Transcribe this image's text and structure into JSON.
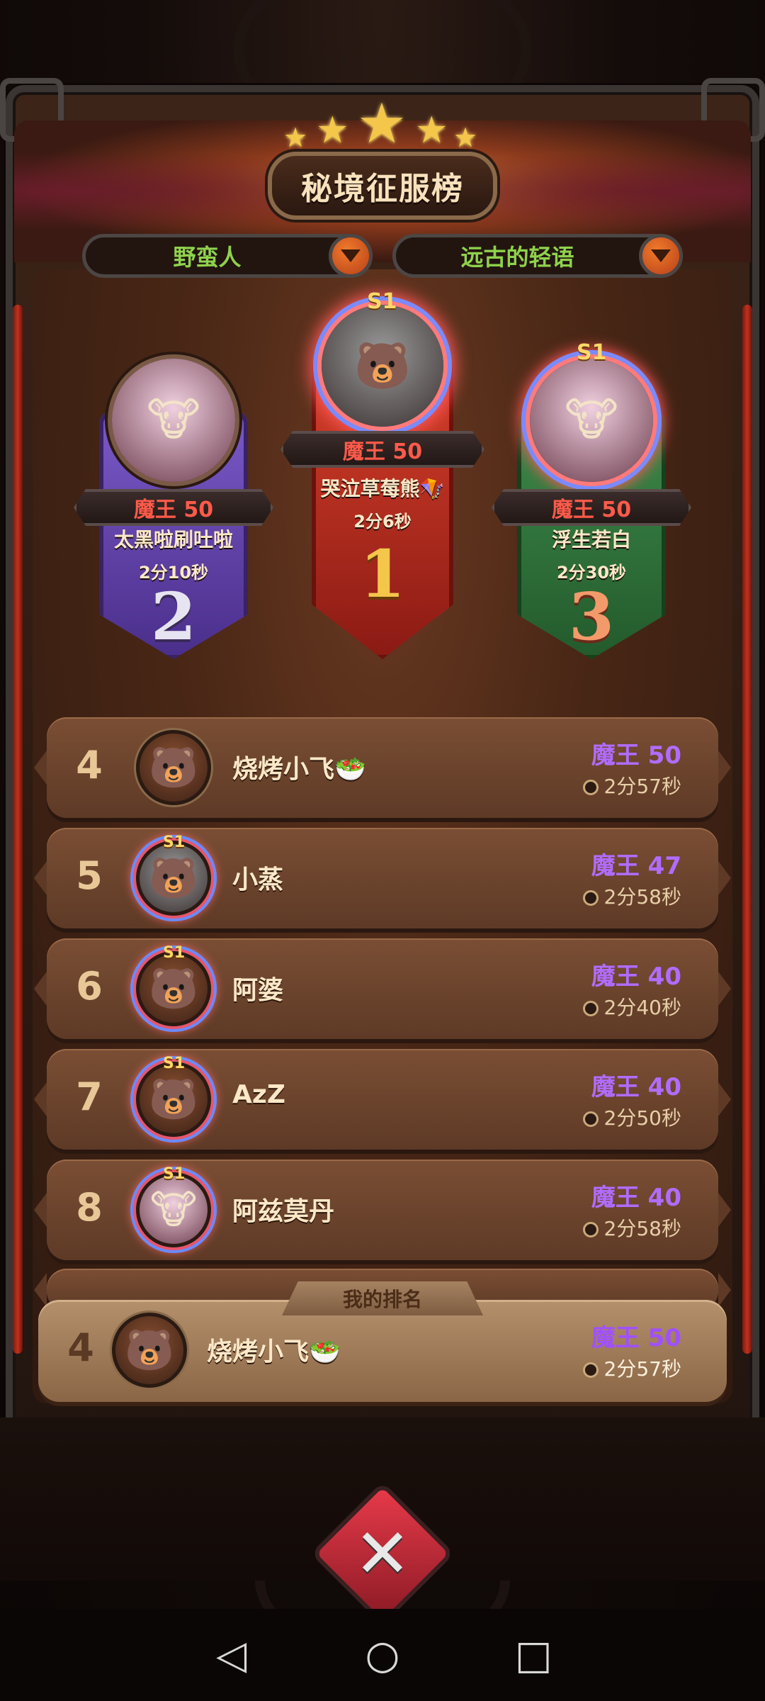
{
  "title": "秘境征服榜",
  "dropdowns": {
    "class_filter": "野蛮人",
    "dungeon_filter": "远古的轻语"
  },
  "podium": [
    {
      "rank": "1",
      "name": "哭泣草莓熊🪁",
      "level": "魔王 50",
      "time": "2分6秒",
      "season_badge": "S1",
      "avatar_icon": "viking-bear-avatar"
    },
    {
      "rank": "2",
      "name": "太黑啦刷吐啦",
      "level": "魔王 50",
      "time": "2分10秒",
      "avatar_icon": "cow-avatar"
    },
    {
      "rank": "3",
      "name": "浮生若白",
      "level": "魔王 50",
      "time": "2分30秒",
      "season_badge": "S1",
      "avatar_icon": "cow-avatar"
    }
  ],
  "list": [
    {
      "rank": "4",
      "name": "烧烤小飞🥗",
      "level": "魔王 50",
      "time": "2分57秒",
      "season_badge": "",
      "avatar_icon": "bear-avatar"
    },
    {
      "rank": "5",
      "name": "小蒸",
      "level": "魔王 47",
      "time": "2分58秒",
      "season_badge": "S1",
      "avatar_icon": "viking-bear-avatar"
    },
    {
      "rank": "6",
      "name": "阿婆",
      "level": "魔王 40",
      "time": "2分40秒",
      "season_badge": "S1",
      "avatar_icon": "bear-avatar"
    },
    {
      "rank": "7",
      "name": "AzZ",
      "level": "魔王 40",
      "time": "2分50秒",
      "season_badge": "S1",
      "avatar_icon": "bear-avatar"
    },
    {
      "rank": "8",
      "name": "阿兹莫丹",
      "level": "魔王 40",
      "time": "2分58秒",
      "season_badge": "S1",
      "avatar_icon": "cow-avatar"
    }
  ],
  "my_rank": {
    "tab_label": "我的排名",
    "rank": "4",
    "name": "烧烤小飞🥗",
    "level": "魔王 50",
    "time": "2分57秒"
  },
  "colors": {
    "accent_green": "#8fd24c",
    "level_red": "#ff5a4a",
    "level_purple": "#b06cff",
    "gold": "#f4c64a"
  },
  "nav": {
    "back_icon": "back-triangle-icon",
    "home_icon": "home-circle-icon",
    "recents_icon": "recents-square-icon"
  }
}
